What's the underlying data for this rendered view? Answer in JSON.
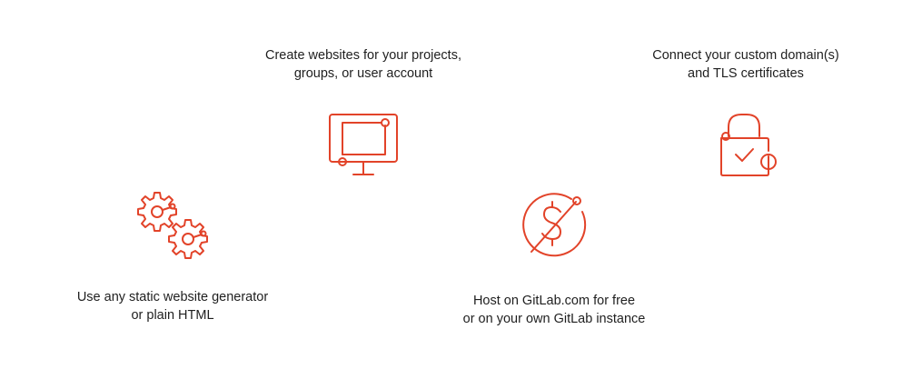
{
  "accent_color": "#e24329",
  "features": {
    "websites": {
      "line1": "Create websites for your projects,",
      "line2": "groups, or user account",
      "icon": "monitor-icon"
    },
    "domains": {
      "line1": "Connect your custom domain(s)",
      "line2": "and TLS certificates",
      "icon": "padlock-check-icon"
    },
    "generator": {
      "line1": "Use any static website generator",
      "line2": "or plain HTML",
      "icon": "gears-icon"
    },
    "hosting": {
      "line1": "Host on GitLab.com for free",
      "line2": "or on your own GitLab instance",
      "icon": "dollar-crossed-icon"
    }
  }
}
